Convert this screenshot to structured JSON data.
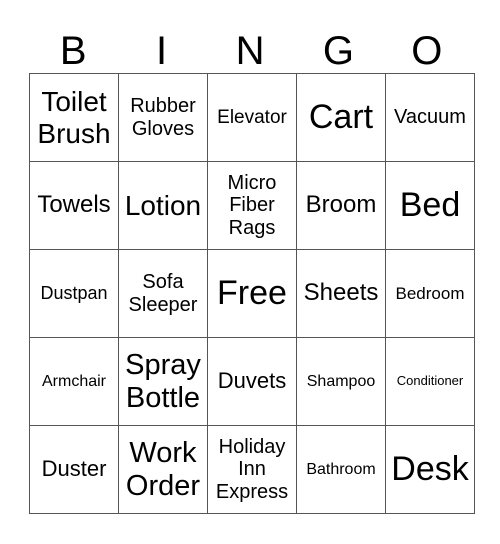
{
  "header": [
    "B",
    "I",
    "N",
    "G",
    "O"
  ],
  "rows": [
    [
      {
        "text": "Toilet Brush",
        "size": 28
      },
      {
        "text": "Rubber Gloves",
        "size": 20
      },
      {
        "text": "Elevator",
        "size": 19
      },
      {
        "text": "Cart",
        "size": 34
      },
      {
        "text": "Vacuum",
        "size": 20
      }
    ],
    [
      {
        "text": "Towels",
        "size": 24
      },
      {
        "text": "Lotion",
        "size": 28
      },
      {
        "text": "Micro Fiber Rags",
        "size": 20
      },
      {
        "text": "Broom",
        "size": 24
      },
      {
        "text": "Bed",
        "size": 34
      }
    ],
    [
      {
        "text": "Dustpan",
        "size": 18
      },
      {
        "text": "Sofa Sleeper",
        "size": 20
      },
      {
        "text": "Free",
        "size": 34
      },
      {
        "text": "Sheets",
        "size": 24
      },
      {
        "text": "Bedroom",
        "size": 17
      }
    ],
    [
      {
        "text": "Armchair",
        "size": 16
      },
      {
        "text": "Spray Bottle",
        "size": 29
      },
      {
        "text": "Duvets",
        "size": 22
      },
      {
        "text": "Shampoo",
        "size": 16
      },
      {
        "text": "Conditioner",
        "size": 13
      }
    ],
    [
      {
        "text": "Duster",
        "size": 22
      },
      {
        "text": "Work Order",
        "size": 29
      },
      {
        "text": "Holiday Inn Express",
        "size": 20
      },
      {
        "text": "Bathroom",
        "size": 16
      },
      {
        "text": "Desk",
        "size": 34
      }
    ]
  ]
}
